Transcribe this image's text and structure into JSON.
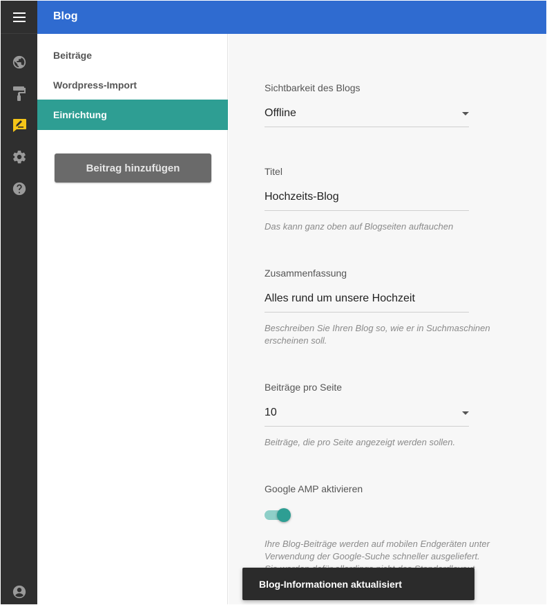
{
  "header": {
    "title": "Blog"
  },
  "rail": {
    "icons": [
      "menu-icon",
      "globe-icon",
      "paint-roller-icon",
      "blog-edit-icon",
      "gear-icon",
      "help-icon",
      "account-icon"
    ],
    "active_color": "#f5c518"
  },
  "sidebar": {
    "items": [
      {
        "label": "Beiträge",
        "active": false
      },
      {
        "label": "Wordpress-Import",
        "active": false
      },
      {
        "label": "Einrichtung",
        "active": true
      }
    ],
    "add_button_label": "Beitrag hinzufügen"
  },
  "form": {
    "visibility": {
      "label": "Sichtbarkeit des Blogs",
      "value": "Offline"
    },
    "title": {
      "label": "Titel",
      "value": "Hochzeits-Blog",
      "hint": "Das kann ganz oben auf Blogseiten auftauchen"
    },
    "summary": {
      "label": "Zusammenfassung",
      "value": "Alles rund um unsere Hochzeit",
      "hint_line1": "Beschreiben Sie Ihren Blog so, wie er in Suchmaschinen",
      "hint_line2": "erscheinen soll."
    },
    "per_page": {
      "label": "Beiträge pro Seite",
      "value": "10",
      "hint": "Beiträge, die pro Seite angezeigt werden sollen."
    },
    "amp": {
      "label": "Google AMP aktivieren",
      "enabled": true,
      "hint_line1": "Ihre Blog-Beiträge werden auf mobilen Endgeräten unter",
      "hint_line2": "Verwendung der Google-Suche schneller ausgeliefert.",
      "hint_line3": "Sie werden dafür allerdings nicht das Standardlayout"
    }
  },
  "snackbar": {
    "message": "Blog-Informationen aktualisiert"
  },
  "colors": {
    "header": "#2f6bd0",
    "accent": "#2e9e93",
    "rail": "#2f2f2f"
  }
}
